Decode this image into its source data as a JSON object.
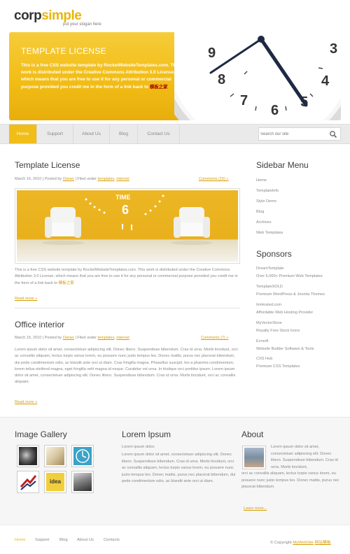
{
  "header": {
    "logo_part1": "corp",
    "logo_part2": "simple",
    "slogan": "put your slogan here"
  },
  "banner": {
    "title": "TEMPLATE LICENSE",
    "text": "This is a free CSS website template by RocketWebsiteTemplates.com. This work is distributed under the Creative Commons Attribution 3.0 License, which means that you are free to use it for any personal or commercial purpose provided you credit me in the form of a link back to",
    "link": "模板之家",
    "clock_numbers": [
      "9",
      "3",
      "8",
      "4",
      "7",
      "6",
      "5"
    ]
  },
  "nav": {
    "items": [
      "Home",
      "Support",
      "About Us",
      "Blog",
      "Contact Us"
    ],
    "active": "Home",
    "search_placeholder": "Search our site"
  },
  "posts": [
    {
      "title": "Template License",
      "date": "March 16, 2010",
      "posted_by": "Posted by",
      "author": "Owner",
      "filed": "Filed under",
      "cat1": "templates",
      "cat2": "internet",
      "comments": "Comments (15) »",
      "text": "This is a free CSS website template by RocketWebsiteTemplates.com. This work is distributed under the Creative Commons Attribution 3.0 License, which means that you are free to use it for any personal or commercial purpose provided you credit me in the form of a link back to",
      "text_link": "模板之家",
      "image_label_time": "TIME",
      "image_label_num": "6",
      "readmore": "Read more »"
    },
    {
      "title": "Office interior",
      "date": "March 15, 2010",
      "posted_by": "Posted by",
      "author": "Owner",
      "filed": "Filed under",
      "cat1": "templates",
      "cat2": "internet",
      "comments": "Comments (7) »",
      "text": "Lorem ipsum dolor sit amet, consectetuer adipiscing elit. Donec libero. Suspendisse bibendum. Cras id urna. Morbi tincidunt, orci ac convallis aliquam, lectus turpis varius lorem, eu posuere nunc justo tempus leo. Donec mattis, purus nec placerat bibendum, dui pede condimentum odio, ac blandit ante orci ut diam. Cras fringilla magna. Phasellus suscipit, leo a pharetra condimentum, lorem tellus eleifend magna, eget fringilla velit magna id neque. Curabitur vel urna. In tristique orci porttitor ipsum. Lorem ipsum dolor sit amet, consectetuer adipiscing elit. Donec libero. Suspendisse bibendum. Cras id urna. Morbi tincidunt, orci ac convallis aliquam.",
      "readmore": "Read more »"
    }
  ],
  "sidebar": {
    "menu_title": "Sidebar Menu",
    "menu": [
      "Home",
      "TemplateInfo",
      "Style Demo",
      "Blog",
      "Archives",
      "Web Templates"
    ],
    "sponsors_title": "Sponsors",
    "sponsors": [
      {
        "name": "DreamTemplate",
        "desc": "Over 6,000+ Premium Web Templates"
      },
      {
        "name": "TemplateSOLD",
        "desc": "Premium WordPress & Joomla Themes"
      },
      {
        "name": "ImHosted.com",
        "desc": "Affordable Web Hosting Provider"
      },
      {
        "name": "MyVectorStore",
        "desc": "Royalty Free Stock Icons"
      },
      {
        "name": "Evrsoft",
        "desc": "Website Builder Software & Tools"
      },
      {
        "name": "CSS Hub",
        "desc": "Premium CSS Templates"
      }
    ]
  },
  "footer": {
    "gallery_title": "Image Gallery",
    "thumb_text": "idea",
    "lorem_title": "Lorem Ipsum",
    "lorem_line1": "Lorem ipsum dolor.",
    "lorem_text": "Lorem ipsum dolor sit amet, consectetuer adipiscing elit. Donec libero. Suspendisse bibendum. Cras id urna. Morbi tincidunt, orci ac convallis aliquam, lectus turpis varius lorem, eu posuere nunc justo tempus leo. Donec mattis, purus nec placerat bibendum, dui pede condimentum odio, ac blandit ante orci ut diam.",
    "about_title": "About",
    "about_text_short": "Lorem ipsum dolor sit amet, consectetuer adipiscing elit. Donec libero. Suspendisse bibendum. Cras id urna. Morbi tincidunt,",
    "about_text_long": "orci ac convallis aliquam, lectus turpis varius lorem, eu posuere nunc justo tempus leo. Donec mattis, purus nec placerat bibendum.",
    "about_more": "Learn more..."
  },
  "bottom": {
    "links": [
      "Home",
      "Support",
      "Blog",
      "About Us",
      "Contacts"
    ],
    "copyright": "© Copyright",
    "copy_link": "MyWebSite",
    "copy_link2": "网站模板"
  },
  "colors": {
    "accent": "#f1bd18",
    "link": "#d69c00"
  }
}
